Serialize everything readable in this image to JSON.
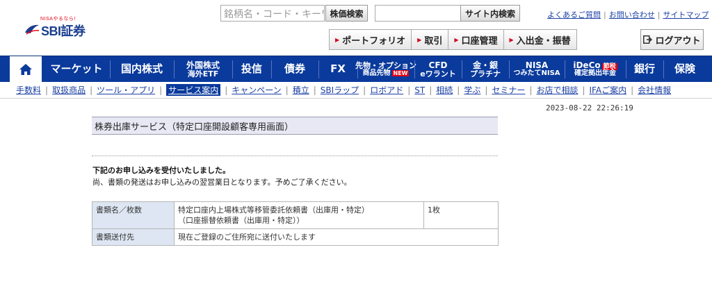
{
  "header": {
    "logo_tagline": "NISAやるなら!",
    "logo_brand": "SBI証券",
    "stock_search_placeholder": "銘柄名・コード・キーワード",
    "stock_search_button": "株価検索",
    "site_search_value": "",
    "site_search_button": "サイト内検索",
    "top_links": [
      "よくあるご質問",
      "お問い合わせ",
      "サイトマップ"
    ],
    "tool_buttons": [
      "ポートフォリオ",
      "取引",
      "口座管理",
      "入出金・振替"
    ],
    "logout_label": "ログアウト"
  },
  "mainnav": {
    "items": [
      {
        "l1": "マーケット",
        "l2": ""
      },
      {
        "l1": "国内株式",
        "l2": ""
      },
      {
        "l1": "外国株式",
        "l2": "海外ETF"
      },
      {
        "l1": "投信",
        "l2": ""
      },
      {
        "l1": "債券",
        "l2": ""
      },
      {
        "l1": "FX",
        "l2": ""
      },
      {
        "l1": "先物・オプション",
        "l2": "商品先物",
        "badge": "NEW"
      },
      {
        "l1": "CFD",
        "l2": "eワラント"
      },
      {
        "l1": "金・銀",
        "l2": "プラチナ"
      },
      {
        "l1": "NISA",
        "l2": "つみたてNISA"
      },
      {
        "l1": "iDeCo",
        "l2": "確定拠出年金",
        "badge": "節税"
      },
      {
        "l1": "銀行",
        "l2": ""
      },
      {
        "l1": "保険",
        "l2": ""
      }
    ]
  },
  "subnav": {
    "items": [
      "手数料",
      "取扱商品",
      "ツール・アプリ",
      "サービス案内",
      "キャンペーン",
      "積立",
      "SBIラップ",
      "ロボアド",
      "ST",
      "相続",
      "学ぶ",
      "セミナー",
      "お店で相談",
      "IFAご案内",
      "会社情報"
    ],
    "active_index": 3
  },
  "timestamp": "2023-08-22 22:26:19",
  "content": {
    "title": "株券出庫サービス（特定口座開設顧客専用画面）",
    "message_strong": "下記のお申し込みを受付いたしました。",
    "message_note": "尚、書類の発送はお申し込みの翌営業日となります。予めご了承ください。",
    "rows": [
      {
        "header": "書類名／枚数",
        "value_line1": "特定口座内上場株式等移管委託依頼書（出庫用・特定）",
        "value_line2": "（口座振替依頼書（出庫用・特定））",
        "count": "1枚"
      },
      {
        "header": "書類送付先",
        "value_line1": "現在ご登録のご住所宛に送付いたします",
        "value_line2": "",
        "count": ""
      }
    ]
  },
  "colors": {
    "nav_blue": "#0a3a9c",
    "link_blue": "#1a3fa4",
    "accent_red": "#e60012",
    "table_header_bg": "#dde6f2",
    "title_bar_bg": "#e8e8f4"
  },
  "icons": [
    "home-icon",
    "logout-icon",
    "red-triangle-icon"
  ]
}
